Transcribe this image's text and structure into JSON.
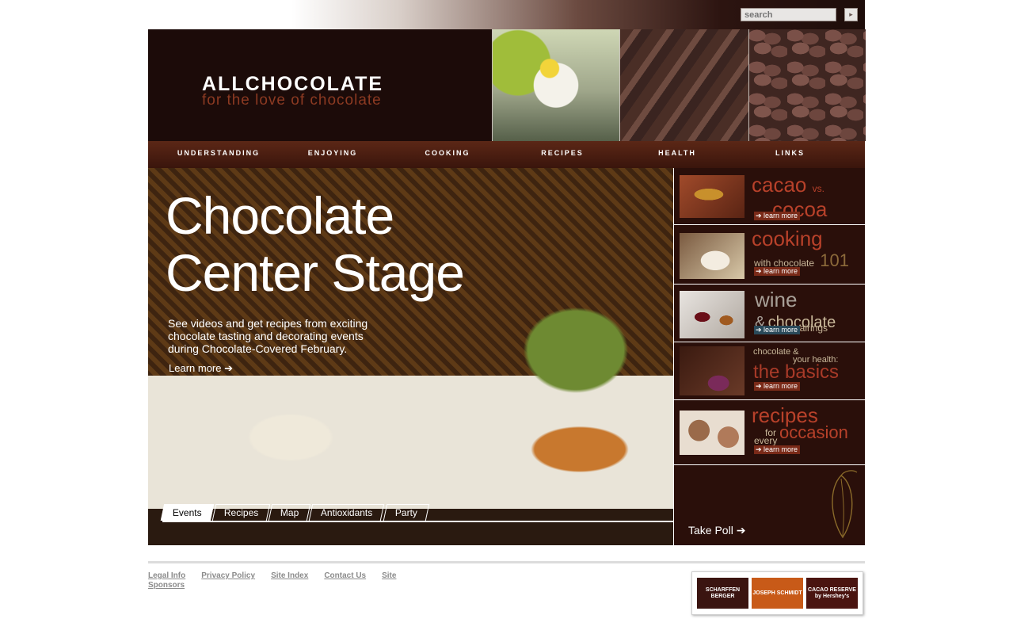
{
  "search": {
    "placeholder": "search",
    "go_glyph": "▸"
  },
  "logo": {
    "title": "ALLCHOCOLATE",
    "tagline": "for the love of chocolate"
  },
  "nav": [
    "UNDERSTANDING",
    "ENJOYING",
    "COOKING",
    "RECIPES",
    "HEALTH",
    "LINKS"
  ],
  "hero": {
    "title_line1": "Chocolate",
    "title_line2": "Center Stage",
    "description": "See videos and get recipes from exciting chocolate tasting and decorating events during Chocolate-Covered February.",
    "learn_more": "Learn more ➔"
  },
  "tabs": [
    "Events",
    "Recipes",
    "Map",
    "Antioxidants",
    "Party"
  ],
  "side": {
    "promos": [
      {
        "title_a": "cacao",
        "title_b": "vs.",
        "title_c": "cocoa",
        "learn": "➔ learn more"
      },
      {
        "title_a": "cooking",
        "title_b": "with chocolate",
        "title_c": "101",
        "learn": "➔ learn more"
      },
      {
        "title_a": "wine",
        "title_b": "&",
        "title_c": "chocolate",
        "title_d": "pairings",
        "learn": "➔ learn more"
      },
      {
        "title_a": "chocolate &",
        "title_b": "your health:",
        "title_c": "the basics",
        "learn": "➔ learn more"
      },
      {
        "title_a": "recipes",
        "title_b": "for",
        "title_c": "every",
        "title_d": "occasion",
        "learn": "➔ learn more"
      }
    ],
    "poll": "Take Poll ➔"
  },
  "footer": {
    "links": [
      "Legal Info",
      "Privacy Policy",
      "Site Index",
      "Contact Us",
      "Site Sponsors"
    ],
    "sponsors": [
      "SCHARFFEN BERGER",
      "JOSEPH SCHMIDT",
      "CACAO RESERVE by Hershey's"
    ]
  },
  "colors": {
    "brand_dark": "#1c0b09",
    "nav": "#4a1c10",
    "accent": "#b8412a",
    "learn_more_bg": "#7a2a18"
  }
}
